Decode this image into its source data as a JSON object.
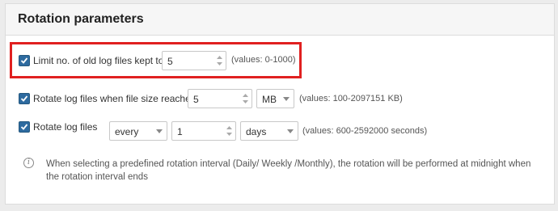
{
  "panel": {
    "title": "Rotation parameters"
  },
  "limit_row": {
    "checked": true,
    "label": "Limit no. of old log files kept to",
    "value": "5",
    "hint": "(values: 0-1000)"
  },
  "size_row": {
    "checked": true,
    "label": "Rotate log files when file size reaches",
    "value": "5",
    "unit": "MB",
    "hint": "(values: 100-2097151 KB)"
  },
  "interval_row": {
    "checked": true,
    "label": "Rotate log files",
    "mode": "every",
    "value": "1",
    "unit": "days",
    "hint": "(values: 600-2592000 seconds)"
  },
  "info": {
    "text": "When selecting a predefined rotation interval (Daily/ Weekly /Monthly), the rotation will be performed at midnight when the rotation interval ends"
  },
  "colors": {
    "checkbox": "#2d6a9f",
    "highlight": "#e02020"
  }
}
